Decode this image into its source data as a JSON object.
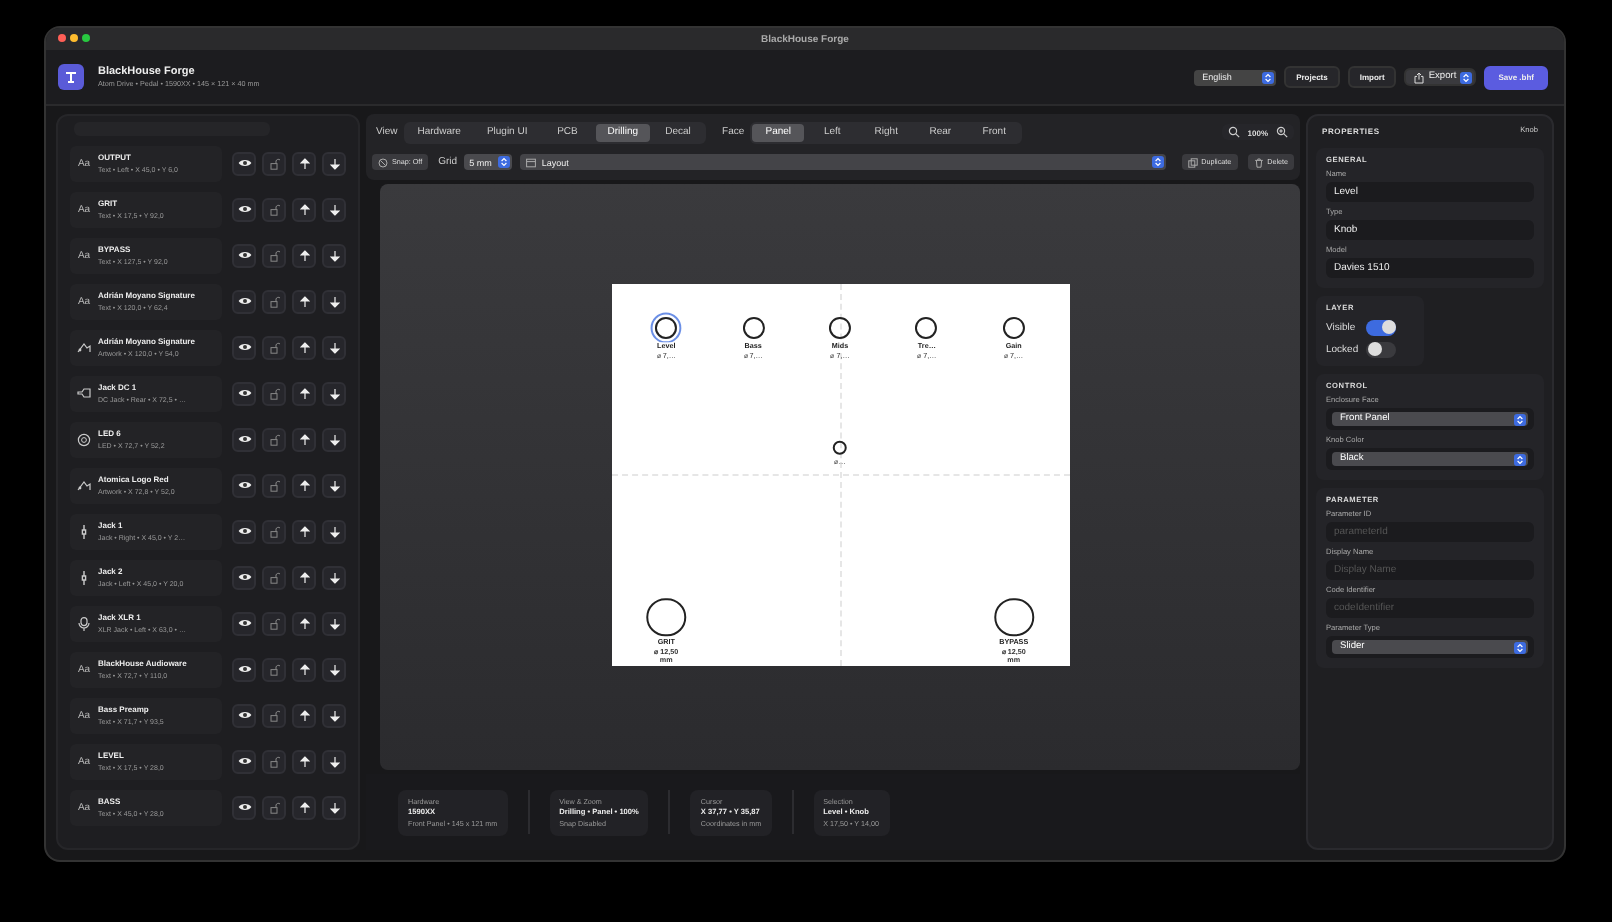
{
  "window": {
    "title": "BlackHouse Forge"
  },
  "header": {
    "title": "BlackHouse Forge",
    "subtitle": "Atom Drive • Pedal • 1590XX • 145 × 121 × 40 mm",
    "language": "English",
    "buttons": [
      {
        "label": "Projects",
        "kind": "plain"
      },
      {
        "label": "Import",
        "kind": "plain"
      },
      {
        "label": "Export",
        "kind": "menu"
      },
      {
        "label": "Save .bhf",
        "kind": "primary"
      }
    ]
  },
  "layers": [
    {
      "kind": "text",
      "glyph": "Aa",
      "name": "OUTPUT",
      "detail": "Text • Left • X 45,0 • Y 6,0",
      "visible": true,
      "locked": false
    },
    {
      "kind": "text",
      "glyph": "Aa",
      "name": "GRIT",
      "detail": "Text • X 17,5 • Y 92,0",
      "visible": true,
      "locked": false
    },
    {
      "kind": "text",
      "glyph": "Aa",
      "name": "BYPASS",
      "detail": "Text • X 127,5 • Y 92,0",
      "visible": true,
      "locked": false
    },
    {
      "kind": "text",
      "glyph": "Aa",
      "name": "Adrián Moyano Signature",
      "detail": "Text • X 120,0 • Y 62,4",
      "visible": true,
      "locked": false
    },
    {
      "kind": "artwork",
      "name": "Adrián Moyano Signature",
      "detail": "Artwork • X 120,0 • Y 54,0",
      "visible": true,
      "locked": false
    },
    {
      "kind": "dcjack",
      "name": "Jack DC 1",
      "detail": "DC Jack • Rear • X 72,5 • …",
      "visible": true,
      "locked": false
    },
    {
      "kind": "led",
      "name": "LED 6",
      "detail": "LED • X 72,7 • Y 52,2",
      "visible": true,
      "locked": false
    },
    {
      "kind": "artwork",
      "name": "Atomica Logo Red",
      "detail": "Artwork • X 72,8 • Y 52,0",
      "visible": true,
      "locked": false
    },
    {
      "kind": "jack",
      "name": "Jack 1",
      "detail": "Jack • Right • X 45,0 • Y 2…",
      "visible": true,
      "locked": false
    },
    {
      "kind": "jack",
      "name": "Jack 2",
      "detail": "Jack • Left • X 45,0 • Y 20,0",
      "visible": true,
      "locked": false
    },
    {
      "kind": "xlr",
      "name": "Jack XLR 1",
      "detail": "XLR Jack • Left • X 63,0 • …",
      "visible": true,
      "locked": false
    },
    {
      "kind": "text",
      "glyph": "Aa",
      "name": "BlackHouse Audioware",
      "detail": "Text • X 72,7 • Y 110,0",
      "visible": true,
      "locked": false
    },
    {
      "kind": "text",
      "glyph": "Aa",
      "name": "Bass Preamp",
      "detail": "Text • X 71,7 • Y 93,5",
      "visible": true,
      "locked": false
    },
    {
      "kind": "text",
      "glyph": "Aa",
      "name": "LEVEL",
      "detail": "Text • X 17,5 • Y 28,0",
      "visible": true,
      "locked": false
    },
    {
      "kind": "text",
      "glyph": "Aa",
      "name": "BASS",
      "detail": "Text • X 45,0 • Y 28,0",
      "visible": true,
      "locked": false
    }
  ],
  "toolbar": {
    "view_label": "View",
    "views": [
      {
        "label": "Hardware",
        "selected": false
      },
      {
        "label": "Plugin UI",
        "selected": false
      },
      {
        "label": "PCB",
        "selected": false
      },
      {
        "label": "Drilling",
        "selected": true
      },
      {
        "label": "Decal",
        "selected": false
      }
    ],
    "face_label": "Face",
    "faces": [
      {
        "label": "Panel",
        "selected": true
      },
      {
        "label": "Left",
        "selected": false
      },
      {
        "label": "Right",
        "selected": false
      },
      {
        "label": "Rear",
        "selected": false
      },
      {
        "label": "Front",
        "selected": false
      }
    ],
    "zoom": "100%",
    "snap": "Snap: Off",
    "grid_label": "Grid",
    "grid": "5 mm",
    "layer_select": "Layout",
    "actions": [
      "Duplicate",
      "Delete"
    ]
  },
  "canvas": {
    "holes": [
      {
        "kind": "knob",
        "label": "Level",
        "diameter": "⌀ 7,…",
        "selected": true
      },
      {
        "kind": "knob",
        "label": "Bass",
        "diameter": "⌀ 7,…",
        "selected": false
      },
      {
        "kind": "knob",
        "label": "Mids",
        "diameter": "⌀ 7,…",
        "selected": false
      },
      {
        "kind": "knob",
        "label": "Tre…",
        "diameter": "⌀ 7,…",
        "selected": false
      },
      {
        "kind": "knob",
        "label": "Gain",
        "diameter": "⌀ 7,…",
        "selected": false
      },
      {
        "kind": "led",
        "diameter": "⌀…",
        "selected": false
      },
      {
        "kind": "switch",
        "label": "GRIT",
        "diameter": "⌀ 12,50 mm",
        "selected": false
      },
      {
        "kind": "switch",
        "label": "BYPASS",
        "diameter": "⌀ 12,50 mm",
        "selected": false
      }
    ]
  },
  "status_bar": [
    {
      "label": "Hardware",
      "value": "1590XX",
      "detail": "Front Panel • 145 x 121 mm"
    },
    {
      "label": "View & Zoom",
      "value": "Drilling • Panel • 100%",
      "detail": "Snap Disabled"
    },
    {
      "label": "Cursor",
      "value": "X 37,77 • Y 35,87",
      "detail": "Coordinates in mm"
    },
    {
      "label": "Selection",
      "value": "Level • Knob",
      "detail": "X 17,50 • Y 14,00"
    }
  ],
  "properties": {
    "title": "PROPERTIES",
    "type": "Knob",
    "sections": [
      {
        "title": "GENERAL",
        "kind": "fields",
        "fields": [
          {
            "kind": "text",
            "label": "Name",
            "value": "Level"
          },
          {
            "kind": "text",
            "label": "Type",
            "value": "Knob"
          },
          {
            "kind": "text",
            "label": "Model",
            "value": "Davies 1510"
          }
        ]
      },
      {
        "title": "LAYER",
        "kind": "toggles",
        "fields": [
          {
            "kind": "toggle",
            "label": "Visible",
            "on": true
          },
          {
            "kind": "toggle",
            "label": "Locked",
            "on": false
          }
        ]
      },
      {
        "title": "CONTROL",
        "kind": "fields",
        "fields": [
          {
            "kind": "select",
            "label": "Enclosure Face",
            "value": "Front Panel"
          },
          {
            "kind": "select",
            "label": "Knob Color",
            "value": "Black"
          }
        ]
      },
      {
        "title": "PARAMETER",
        "kind": "fields",
        "fields": [
          {
            "kind": "text",
            "label": "Parameter ID",
            "placeholder": "parameterId"
          },
          {
            "kind": "text",
            "label": "Display Name",
            "placeholder": "Display Name"
          },
          {
            "kind": "text",
            "label": "Code Identifier",
            "placeholder": "codeIdentifier"
          },
          {
            "kind": "select",
            "label": "Parameter Type",
            "value": "Slider"
          }
        ]
      }
    ]
  }
}
